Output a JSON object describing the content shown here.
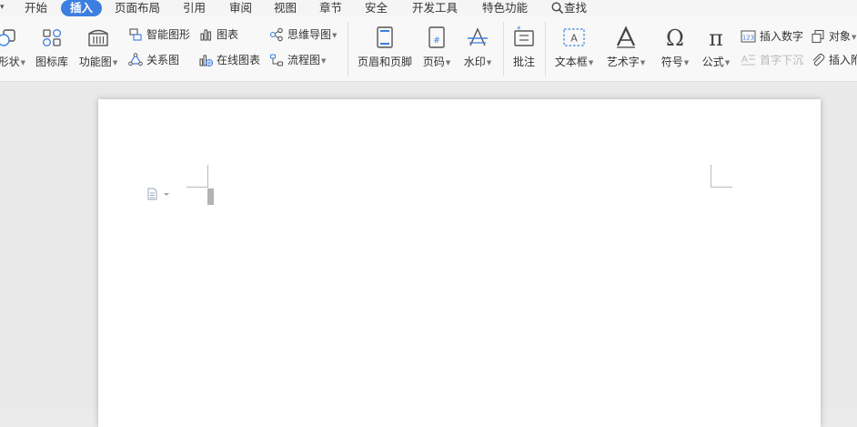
{
  "menu": {
    "items": [
      {
        "label": "开始"
      },
      {
        "label": "插入",
        "active": true
      },
      {
        "label": "页面布局"
      },
      {
        "label": "引用"
      },
      {
        "label": "审阅"
      },
      {
        "label": "视图"
      },
      {
        "label": "章节"
      },
      {
        "label": "安全"
      },
      {
        "label": "开发工具"
      },
      {
        "label": "特色功能"
      }
    ],
    "search_label": "查找",
    "accent_color": "#3d7fe0"
  },
  "ribbon": {
    "shape": "形状",
    "icon_library": "图标库",
    "function_chart": "功能图",
    "smart_graphic": "智能图形",
    "chart": "图表",
    "relation_chart": "关系图",
    "online_chart": "在线图表",
    "mind_map": "思维导图",
    "flow_chart": "流程图",
    "header_footer": "页眉和页脚",
    "page_number": "页码",
    "watermark": "水印",
    "comment": "批注",
    "text_box": "文本框",
    "word_art": "艺术字",
    "symbol": "符号",
    "formula": "公式",
    "insert_number": "插入数字",
    "drop_cap": "首字下沉",
    "object": "对象",
    "insert_attachment": "插入附"
  }
}
